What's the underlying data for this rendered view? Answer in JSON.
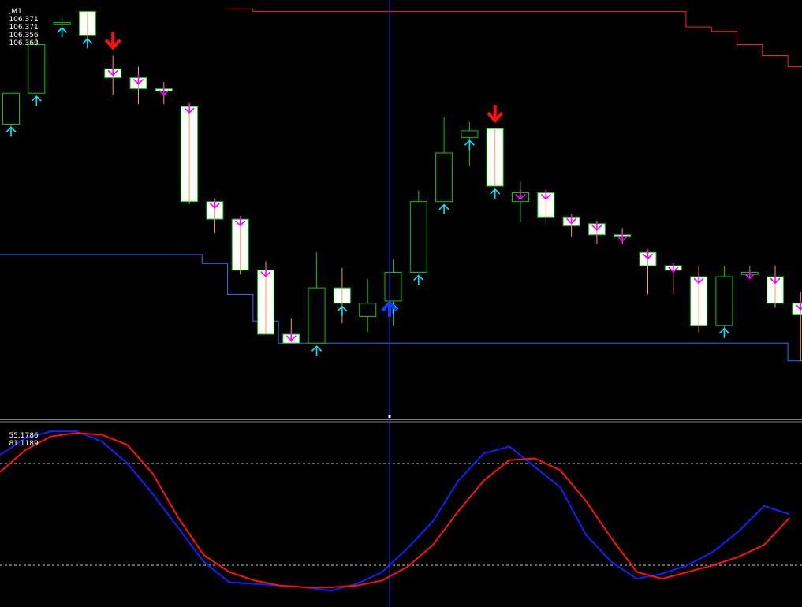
{
  "main_window": {
    "header_symbol": ",M1",
    "header_ohlc": [
      "106.371",
      "106.371",
      "106.356",
      "106.360"
    ]
  },
  "oscillator_window": {
    "header_values": [
      "55.1786",
      "81.1189"
    ]
  },
  "colors": {
    "background": "#000000",
    "bull_body": "#000000",
    "bull_outline": "#00c800",
    "bear_body": "#ffffff",
    "bear_outline": "#00c800",
    "bear_wick": "#ffa040",
    "buy_arrow": "#00e5ff",
    "sell_arrow": "#ff00ff",
    "big_buy_arrow": "#1040ff",
    "big_sell_arrow": "#ff1010",
    "upper_channel": "#ff2020",
    "lower_channel": "#2a6cff",
    "crosshair": "#2030ff",
    "stoch_main": "#1020ff",
    "stoch_signal": "#ff1010",
    "level_lines": "#c8c8c8"
  },
  "chart_data": [
    {
      "type": "candlestick",
      "title": "",
      "header": ",M1 106.371 106.371 106.356 106.360",
      "ylim": [
        106.23,
        106.374
      ],
      "candles": [
        {
          "o": 106.32,
          "h": 106.327,
          "l": 106.315,
          "c": 106.334,
          "dir": "up"
        },
        {
          "o": 106.334,
          "h": 106.359,
          "l": 106.334,
          "c": 106.356,
          "dir": "up"
        },
        {
          "o": 106.365,
          "h": 106.368,
          "l": 106.363,
          "c": 106.366,
          "dir": "up"
        },
        {
          "o": 106.371,
          "h": 106.371,
          "l": 106.356,
          "c": 106.36,
          "dir": "down"
        },
        {
          "o": 106.345,
          "h": 106.351,
          "l": 106.333,
          "c": 106.341,
          "dir": "down"
        },
        {
          "o": 106.341,
          "h": 106.346,
          "l": 106.329,
          "c": 106.336,
          "dir": "down"
        },
        {
          "o": 106.336,
          "h": 106.339,
          "l": 106.329,
          "c": 106.335,
          "dir": "down"
        },
        {
          "o": 106.328,
          "h": 106.328,
          "l": 106.284,
          "c": 106.285,
          "dir": "down"
        },
        {
          "o": 106.285,
          "h": 106.285,
          "l": 106.271,
          "c": 106.277,
          "dir": "down"
        },
        {
          "o": 106.277,
          "h": 106.277,
          "l": 106.252,
          "c": 106.254,
          "dir": "down"
        },
        {
          "o": 106.254,
          "h": 106.258,
          "l": 106.225,
          "c": 106.225,
          "dir": "down"
        },
        {
          "o": 106.225,
          "h": 106.232,
          "l": 106.221,
          "c": 106.221,
          "dir": "down"
        },
        {
          "o": 106.221,
          "h": 106.262,
          "l": 106.221,
          "c": 106.246,
          "dir": "up"
        },
        {
          "o": 106.246,
          "h": 106.255,
          "l": 106.23,
          "c": 106.239,
          "dir": "down"
        },
        {
          "o": 106.233,
          "h": 106.25,
          "l": 106.226,
          "c": 106.239,
          "dir": "up"
        },
        {
          "o": 106.24,
          "h": 106.259,
          "l": 106.229,
          "c": 106.253,
          "dir": "up"
        },
        {
          "o": 106.253,
          "h": 106.29,
          "l": 106.253,
          "c": 106.285,
          "dir": "up"
        },
        {
          "o": 106.285,
          "h": 106.323,
          "l": 106.285,
          "c": 106.307,
          "dir": "up"
        },
        {
          "o": 106.314,
          "h": 106.321,
          "l": 106.301,
          "c": 106.317,
          "dir": "up"
        },
        {
          "o": 106.318,
          "h": 106.318,
          "l": 106.292,
          "c": 106.292,
          "dir": "down"
        },
        {
          "o": 106.289,
          "h": 106.294,
          "l": 106.276,
          "c": 106.285,
          "dir": "up"
        },
        {
          "o": 106.289,
          "h": 106.29,
          "l": 106.275,
          "c": 106.278,
          "dir": "down"
        },
        {
          "o": 106.278,
          "h": 106.278,
          "l": 106.269,
          "c": 106.274,
          "dir": "down"
        },
        {
          "o": 106.275,
          "h": 106.275,
          "l": 106.266,
          "c": 106.27,
          "dir": "down"
        },
        {
          "o": 106.27,
          "h": 106.273,
          "l": 106.266,
          "c": 106.269,
          "dir": "down"
        },
        {
          "o": 106.262,
          "h": 106.262,
          "l": 106.243,
          "c": 106.256,
          "dir": "down"
        },
        {
          "o": 106.256,
          "h": 106.256,
          "l": 106.243,
          "c": 106.254,
          "dir": "down"
        },
        {
          "o": 106.251,
          "h": 106.256,
          "l": 106.226,
          "c": 106.229,
          "dir": "down"
        },
        {
          "o": 106.229,
          "h": 106.256,
          "l": 106.227,
          "c": 106.251,
          "dir": "up"
        },
        {
          "o": 106.253,
          "h": 106.256,
          "l": 106.25,
          "c": 106.252,
          "dir": "up"
        },
        {
          "o": 106.251,
          "h": 106.256,
          "l": 106.237,
          "c": 106.239,
          "dir": "down"
        },
        {
          "o": 106.239,
          "h": 106.244,
          "l": 106.213,
          "c": 106.234,
          "dir": "down"
        }
      ],
      "upper_channel": [
        null,
        null,
        null,
        null,
        null,
        null,
        null,
        null,
        null,
        106.372,
        106.371,
        106.371,
        106.371,
        106.371,
        106.371,
        106.371,
        106.371,
        106.371,
        106.371,
        106.371,
        106.371,
        106.371,
        106.371,
        106.371,
        106.371,
        106.371,
        106.371,
        106.364,
        106.362,
        106.356,
        106.351,
        106.346
      ],
      "lower_channel": [
        106.261,
        106.261,
        106.261,
        106.261,
        106.261,
        106.261,
        106.261,
        106.261,
        106.257,
        106.243,
        106.231,
        106.221,
        106.221,
        106.221,
        106.221,
        106.221,
        106.221,
        106.221,
        106.221,
        106.221,
        106.221,
        106.221,
        106.221,
        106.221,
        106.221,
        106.221,
        106.221,
        106.221,
        106.221,
        106.221,
        106.221,
        106.213
      ],
      "buy_arrows": [
        0,
        1,
        2,
        3,
        12,
        13,
        15,
        16,
        17,
        18,
        19,
        28
      ],
      "sell_arrows": [
        4,
        5,
        6,
        7,
        8,
        9,
        10,
        11,
        20,
        21,
        22,
        23,
        24,
        25,
        26,
        27,
        29,
        30,
        31
      ],
      "big_sell_arrows": [
        4,
        19
      ],
      "big_buy_arrows": [
        15
      ]
    },
    {
      "type": "line",
      "title": "",
      "header": "55.1786 81.1189",
      "ylim": [
        0,
        100
      ],
      "levels": [
        80,
        20
      ],
      "series": [
        {
          "values": [
            85,
            95,
            99,
            99,
            93,
            80,
            62,
            42,
            22,
            10,
            9,
            8,
            7,
            5,
            9,
            16,
            30,
            46,
            70,
            86,
            90,
            78,
            66,
            38,
            22,
            12,
            15,
            20,
            28,
            40,
            55,
            50
          ]
        },
        {
          "values": [
            75,
            88,
            96,
            98,
            97,
            91,
            74,
            48,
            26,
            16,
            11,
            8,
            7,
            7,
            8,
            11,
            19,
            32,
            52,
            70,
            82,
            83,
            76,
            58,
            36,
            16,
            12,
            16,
            20,
            25,
            32,
            48
          ]
        }
      ]
    }
  ]
}
